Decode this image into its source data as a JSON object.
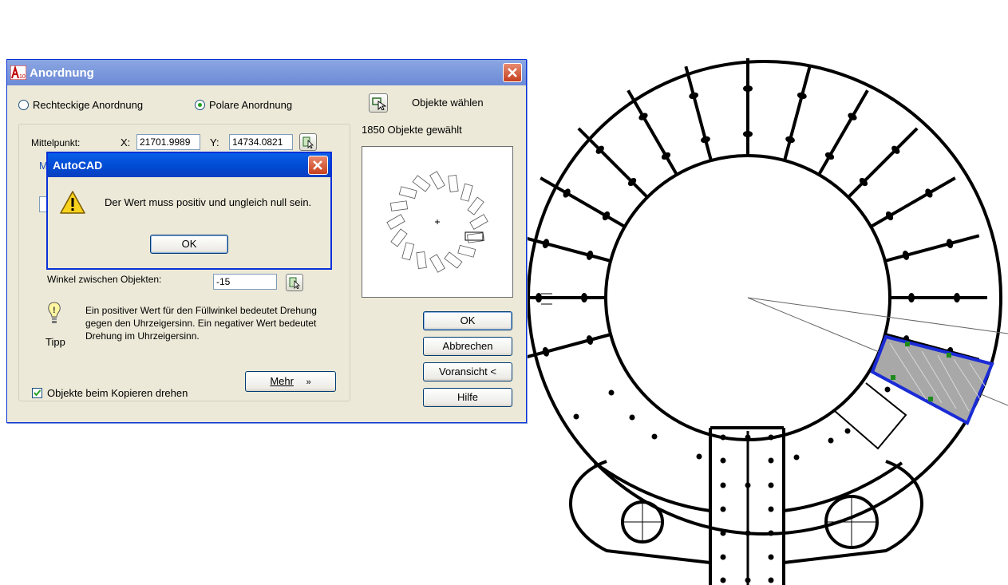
{
  "main_dialog": {
    "title": "Anordnung",
    "radio_rect": "Rechteckige Anordnung",
    "radio_polar": "Polare Anordnung",
    "select_objects": "Objekte wählen",
    "objects_selected": "1850 Objekte gewählt",
    "center_label": "Mittelpunkt:",
    "x_label": "X:",
    "x_value": "21701.9989",
    "y_label": "Y:",
    "y_value": "14734.0821",
    "method_fragment": "M",
    "angle_between_label": "Winkel zwischen Objekten:",
    "angle_between_value": "-15",
    "tip_text": "Ein positiver Wert für den Füllwinkel bedeutet Drehung gegen den Uhrzeigersinn. Ein negativer Wert bedeutet Drehung im Uhrzeigersinn.",
    "tip_label": "Tipp",
    "more_button": "Mehr",
    "rotate_checkbox": "Objekte beim Kopieren drehen",
    "rotate_checked": true,
    "ok_button": "OK",
    "cancel_button": "Abbrechen",
    "preview_button": "Voransicht <",
    "help_button": "Hilfe"
  },
  "message_box": {
    "title": "AutoCAD",
    "message": "Der Wert muss positiv und ungleich null sein.",
    "ok_button": "OK",
    "icon": "warning-icon"
  },
  "colors": {
    "dialog_bg": "#ece9d8",
    "title_active": "#0a5fe8",
    "title_inactive": "#7a96df",
    "selection_outline": "#1a2bd6",
    "selection_fill": "#a8a8a8"
  }
}
